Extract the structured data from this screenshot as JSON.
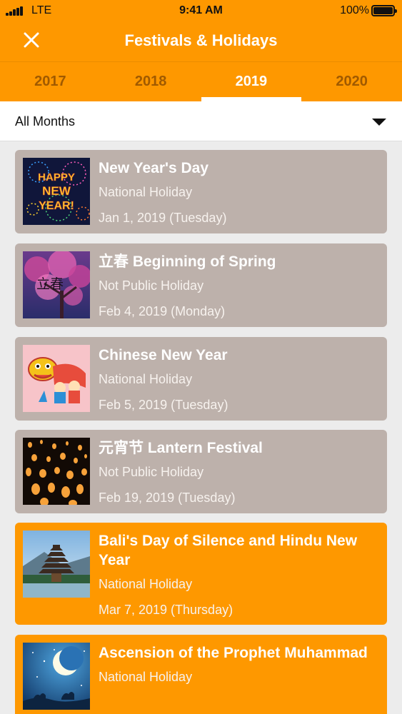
{
  "status_bar": {
    "carrier": "LTE",
    "time": "9:41 AM",
    "battery": "100%"
  },
  "header": {
    "title": "Festivals & Holidays",
    "close_icon": "close-icon"
  },
  "tabs": [
    {
      "label": "2017",
      "active": false
    },
    {
      "label": "2018",
      "active": false
    },
    {
      "label": "2019",
      "active": true
    },
    {
      "label": "2020",
      "active": false
    }
  ],
  "month_filter": {
    "selected": "All Months"
  },
  "colors": {
    "accent": "#fe9800",
    "card_grey": "#bdb1ab"
  },
  "holidays": [
    {
      "name": "New Year's Day",
      "type": "National Holiday",
      "date": "Jan 1, 2019 (Tuesday)",
      "highlight": false,
      "image_text": "HAPPY NEW YEAR!"
    },
    {
      "name": "立春 Beginning of Spring",
      "type": "Not Public Holiday",
      "date": "Feb 4, 2019 (Monday)",
      "highlight": false,
      "image_text": "立春"
    },
    {
      "name": "Chinese New Year",
      "type": "National Holiday",
      "date": "Feb 5, 2019 (Tuesday)",
      "highlight": false
    },
    {
      "name": "元宵节 Lantern Festival",
      "type": "Not Public Holiday",
      "date": "Feb 19, 2019 (Tuesday)",
      "highlight": false
    },
    {
      "name": "Bali's Day of Silence and Hindu New Year",
      "type": "National Holiday",
      "date": "Mar 7, 2019 (Thursday)",
      "highlight": true
    },
    {
      "name": "Ascension of the Prophet Muhammad",
      "type": "National Holiday",
      "date": "",
      "highlight": true
    }
  ]
}
